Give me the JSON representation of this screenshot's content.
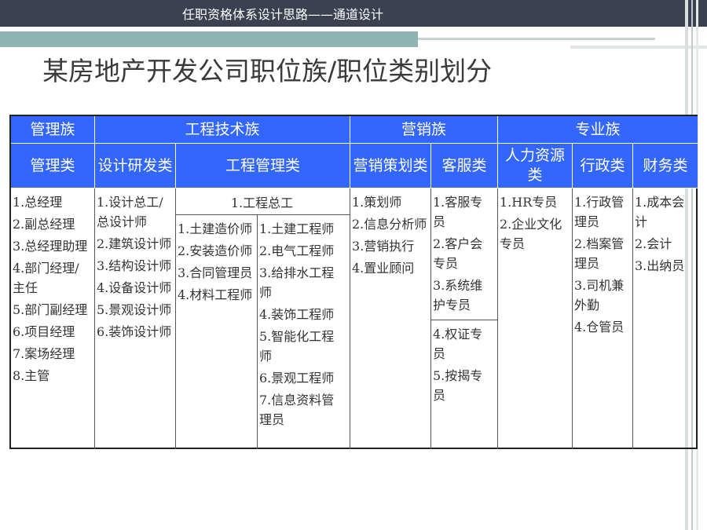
{
  "header": {
    "title": "任职资格体系设计思路——通道设计"
  },
  "page_title": "某房地产开发公司职位族/职位类别划分",
  "families": [
    "管理族",
    "工程技术族",
    "营销族",
    "专业族"
  ],
  "categories": [
    "管理类",
    "设计研发类",
    "工程管理类",
    "营销策划类",
    "客服类",
    "人力资源类",
    "行政类",
    "财务类"
  ],
  "columns": {
    "management": [
      "1.总经理",
      "2.副总经理",
      "3.总经理助理",
      "4.部门经理/主任",
      "5.部门副经理",
      "6.项目经理",
      "7.案场经理",
      "8.主管"
    ],
    "design": [
      "1.设计总工/总设计师",
      "2.建筑设计师",
      "3.结构设计师",
      "4.设备设计师",
      "5.景观设计师",
      "6.装饰设计师"
    ],
    "eng_top": "1.工程总工",
    "eng_left": [
      "1.土建造价师",
      "2.安装造价师",
      "3.合同管理员",
      "4.材料工程师"
    ],
    "eng_right": [
      "1.土建工程师",
      "2.电气工程师",
      "3.给排水工程师",
      "4.装饰工程师",
      "5.智能化工程师",
      "6.景观工程师",
      "7.信息资料管理员"
    ],
    "marketing": [
      "1.策划师",
      "2.信息分析师",
      "3.营销执行",
      "4.置业顾问"
    ],
    "service_top": [
      "1.客服专员",
      "2.客户会专员",
      "3.系统维护专员"
    ],
    "service_bottom": [
      "4.权证专员",
      "5.按揭专员"
    ],
    "hr": [
      "1.HR专员",
      "2.企业文化专员"
    ],
    "admin": [
      "1.行政管理员",
      "2.档案管理员",
      "3.司机兼外勤",
      "4.仓管员"
    ],
    "finance": [
      "1.成本会计",
      "2.会计",
      "3.出纳员"
    ]
  }
}
